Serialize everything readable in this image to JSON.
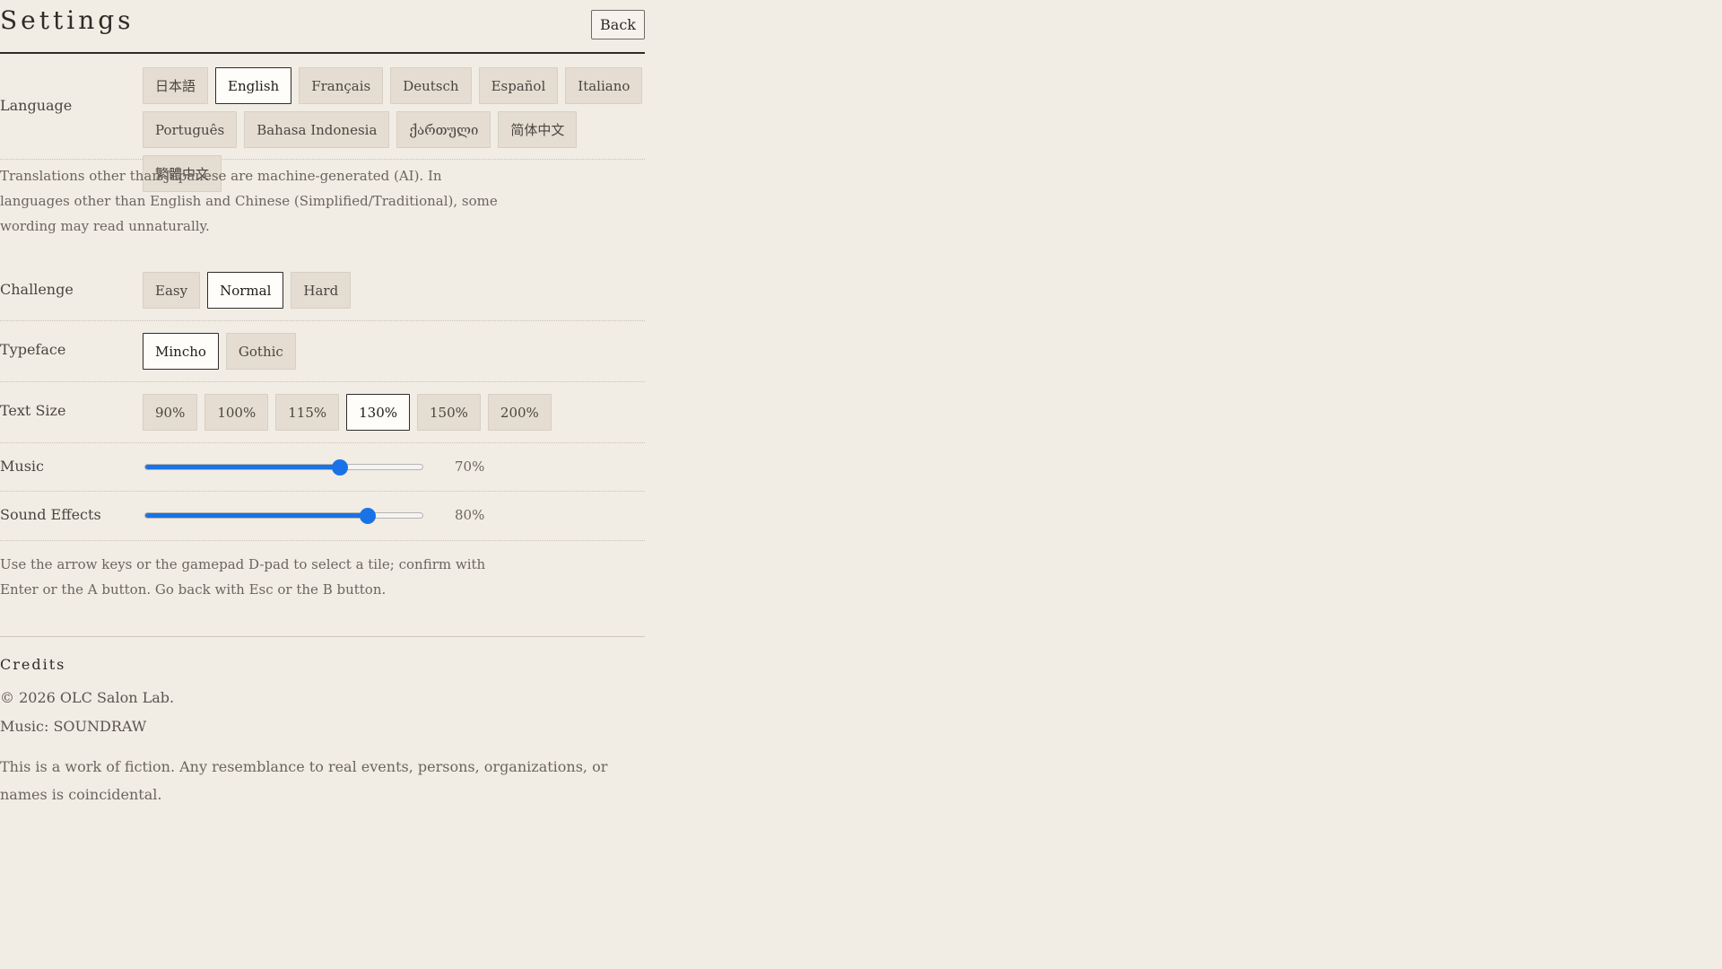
{
  "header": {
    "title": "Settings",
    "back_label": "Back"
  },
  "language": {
    "label": "Language",
    "options": [
      "日本語",
      "English",
      "Français",
      "Deutsch",
      "Español",
      "Italiano",
      "Português",
      "Bahasa Indonesia",
      "ქართული",
      "简体中文",
      "繁體中文"
    ],
    "selected": "English",
    "note": "Translations other than Japanese are machine-generated (AI). In languages other than English and Chinese (Simplified/Traditional), some wording may read unnaturally."
  },
  "challenge": {
    "label": "Challenge",
    "options": [
      "Easy",
      "Normal",
      "Hard"
    ],
    "selected": "Normal"
  },
  "typeface": {
    "label": "Typeface",
    "options": [
      "Mincho",
      "Gothic"
    ],
    "selected": "Mincho"
  },
  "text_size": {
    "label": "Text Size",
    "options": [
      "90%",
      "100%",
      "115%",
      "130%",
      "150%",
      "200%"
    ],
    "selected": "130%"
  },
  "music": {
    "label": "Music",
    "value": 70,
    "value_text": "70%"
  },
  "sound_effects": {
    "label": "Sound Effects",
    "value": 80,
    "value_text": "80%"
  },
  "controls_note": "Use the arrow keys or the gamepad D-pad to select a tile; confirm with Enter or the A button. Go back with Esc or the B button.",
  "credits": {
    "heading": "Credits",
    "copyright": "© 2026 OLC Salon Lab.",
    "music": "Music: SOUNDRAW",
    "disclaimer": "This is a work of fiction. Any resemblance to real events, persons, organizations, or names is coincidental."
  },
  "colors": {
    "background": "#f1ece4",
    "chip": "#e5ddd1",
    "chip_selected": "#fffdf9",
    "accent": "#1973e6",
    "text": "#4a4541"
  }
}
